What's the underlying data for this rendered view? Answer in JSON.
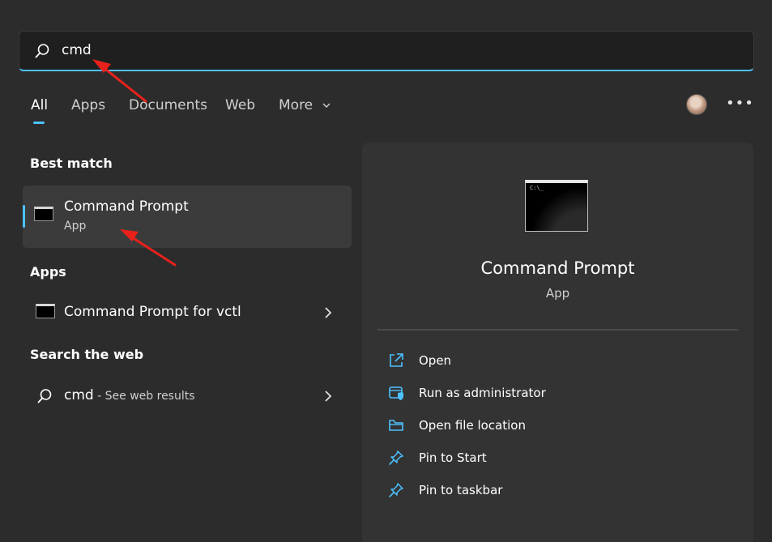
{
  "search": {
    "query": "cmd"
  },
  "tabs": [
    {
      "label": "All",
      "active": true
    },
    {
      "label": "Apps"
    },
    {
      "label": "Documents"
    },
    {
      "label": "Web"
    },
    {
      "label": "More"
    }
  ],
  "best_match": {
    "heading": "Best match",
    "title": "Command Prompt",
    "subtitle": "App"
  },
  "apps": {
    "heading": "Apps",
    "items": [
      {
        "label": "Command Prompt for vctl"
      }
    ]
  },
  "web": {
    "heading": "Search the web",
    "query": "cmd",
    "suffix": " - See web results"
  },
  "preview": {
    "title": "Command Prompt",
    "subtitle": "App",
    "actions": [
      {
        "label": "Open",
        "icon": "open-external-icon"
      },
      {
        "label": "Run as administrator",
        "icon": "shield-window-icon"
      },
      {
        "label": "Open file location",
        "icon": "folder-icon"
      },
      {
        "label": "Pin to Start",
        "icon": "pin-icon"
      },
      {
        "label": "Pin to taskbar",
        "icon": "pin-icon"
      }
    ]
  },
  "header": {
    "options_glyph": "•••"
  },
  "colors": {
    "accent": "#4cc2ff",
    "background": "#2c2c2c",
    "panel": "#333333",
    "annotation": "#e8221b"
  }
}
